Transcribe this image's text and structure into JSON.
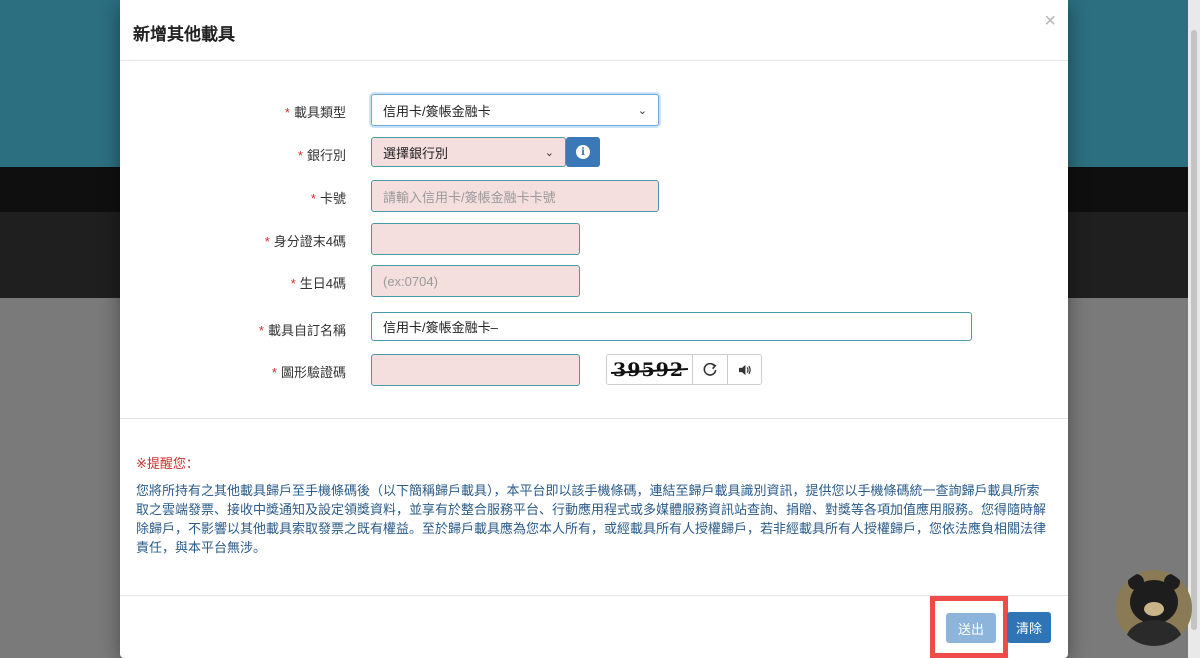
{
  "modal": {
    "title": "新增其他載具",
    "close": "×"
  },
  "form": {
    "carrier_type": {
      "label": "載具類型",
      "value": "信用卡/簽帳金融卡"
    },
    "bank": {
      "label": "銀行別",
      "value": "選擇銀行別"
    },
    "card_number": {
      "label": "卡號",
      "placeholder": "請輸入信用卡/簽帳金融卡卡號"
    },
    "id_last4": {
      "label": "身分證末4碼",
      "value": ""
    },
    "birthday4": {
      "label": "生日4碼",
      "placeholder": "(ex:0704)"
    },
    "custom_name": {
      "label": "載具自訂名稱",
      "value": "信用卡/簽帳金融卡–"
    },
    "captcha": {
      "label": "圖形驗證碼",
      "value": "",
      "image_text": "39592"
    },
    "required_mark": "*"
  },
  "icons": {
    "info": "info-icon",
    "refresh": "refresh-icon",
    "audio": "speaker-icon"
  },
  "reminder": {
    "title": "※提醒您：",
    "text": "您將所持有之其他載具歸戶至手機條碼後（以下簡稱歸戶載具），本平台即以該手機條碼，連結至歸戶載具識別資訊，提供您以手機條碼統一查詢歸戶載具所索取之雲端發票、接收中獎通知及設定領獎資料，並享有於整合服務平台、行動應用程式或多媒體服務資訊站查詢、捐贈、對獎等各項加值應用服務。您得隨時解除歸戶，不影響以其他載具索取發票之既有權益。至於歸戶載具應為您本人所有，或經載具所有人授權歸戶，若非經載具所有人授權歸戶，您依法應負相關法律責任，與本平台無涉。"
  },
  "footer": {
    "submit_label": "送出",
    "clear_label": "清除"
  },
  "colors": {
    "required": "#c9302c",
    "primary": "#2f74b5",
    "highlight": "#f04b4b"
  }
}
